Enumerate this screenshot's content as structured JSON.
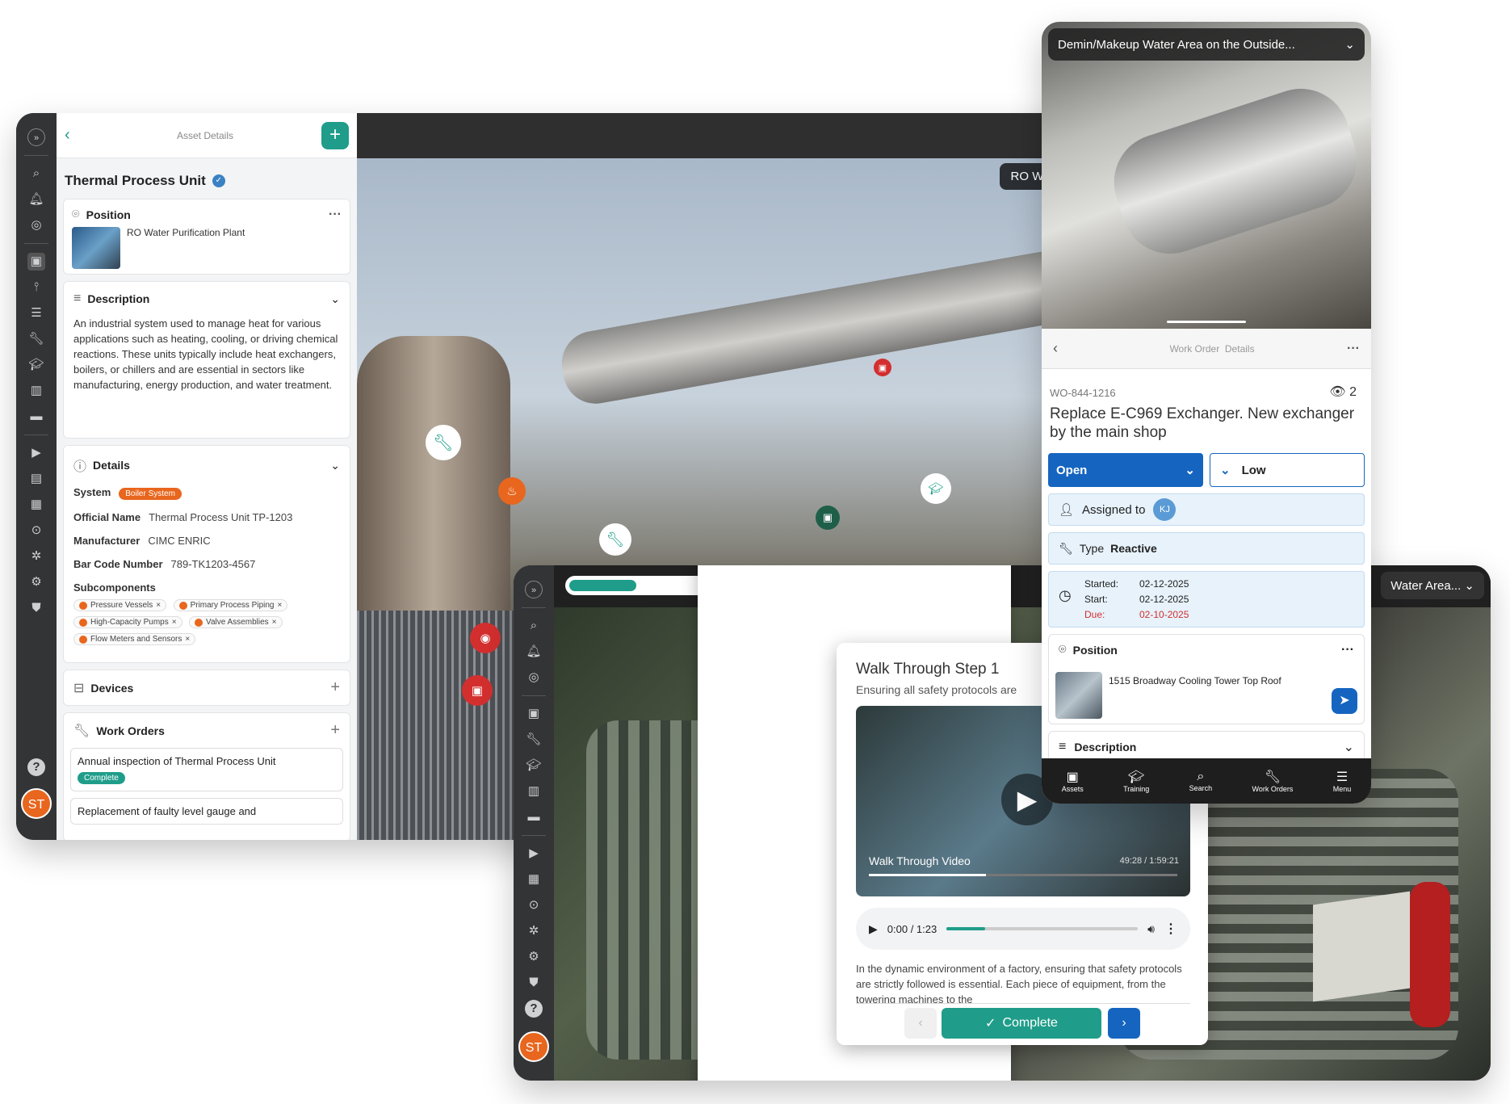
{
  "left_app": {
    "header_title": "Asset Details",
    "asset_name": "Thermal Process Unit",
    "position_label": "Position",
    "position_value": "RO Water Purification Plant",
    "description_label": "Description",
    "description_text": "An industrial system used to manage heat for various applications such as heating, cooling, or driving chemical reactions. These units typically include heat exchangers, boilers, or chillers and are essential in sectors like manufacturing, energy production, and water treatment.",
    "details_label": "Details",
    "system_label": "System",
    "system_value": "Boiler System",
    "official_name_label": "Official Name",
    "official_name_value": "Thermal Process Unit TP-1203",
    "manufacturer_label": "Manufacturer",
    "manufacturer_value": "CIMC ENRIC",
    "barcode_label": "Bar Code Number",
    "barcode_value": "789-TK1203-4567",
    "subcomponents_label": "Subcomponents",
    "subcomponents": [
      "Pressure Vessels",
      "Primary Process Piping",
      "High-Capacity Pumps",
      "Valve Assemblies",
      "Flow Meters and Sensors"
    ],
    "devices_label": "Devices",
    "work_orders_label": "Work Orders",
    "work_order_1": "Annual inspection of Thermal Process Unit",
    "work_order_1_status": "Complete",
    "work_order_2": "Replacement of faulty level gauge and",
    "avatar": "ST",
    "scene_title": "RO Water Purifi"
  },
  "mobile": {
    "location_title": "Demin/Makeup Water Area on the Outside...",
    "header_title": "Work Order  Details",
    "wo_number": "WO-844-1216",
    "views": "2",
    "wo_title": "Replace E-C969 Exchanger. New exchanger by the main shop",
    "status": "Open",
    "priority": "Low",
    "assigned_label": "Assigned to",
    "assigned_initials": "KJ",
    "type_label": "Type",
    "type_value": "Reactive",
    "started_label": "Started:",
    "started_value": "02-12-2025",
    "start_label": "Start:",
    "start_value": "02-12-2025",
    "due_label": "Due:",
    "due_value": "02-10-2025",
    "position_label": "Position",
    "position_value": "1515 Broadway Cooling Tower Top Roof",
    "description_label": "Description",
    "nav": [
      "Assets",
      "Training",
      "Search",
      "Work Orders",
      "Menu"
    ],
    "colors": {
      "primary": "#1565c0",
      "teal": "#1f9d8a",
      "orange": "#e8661e"
    }
  },
  "bottom_app": {
    "location_title": "Water Area...",
    "step_title": "Walk Through Step 1",
    "step_sub": "Ensuring all safety protocols are",
    "video_label": "Walk Through Video",
    "video_time": "49:28 / 1:59:21",
    "audio_time": "0:00 / 1:23",
    "body_text": "In the dynamic environment of a factory, ensuring that safety protocols are strictly followed is essential. Each piece of equipment, from the towering machines to the",
    "complete_label": "Complete",
    "avatar": "ST",
    "progress": 0.26,
    "audio_progress": 0.2,
    "video_progress": 0.38
  }
}
